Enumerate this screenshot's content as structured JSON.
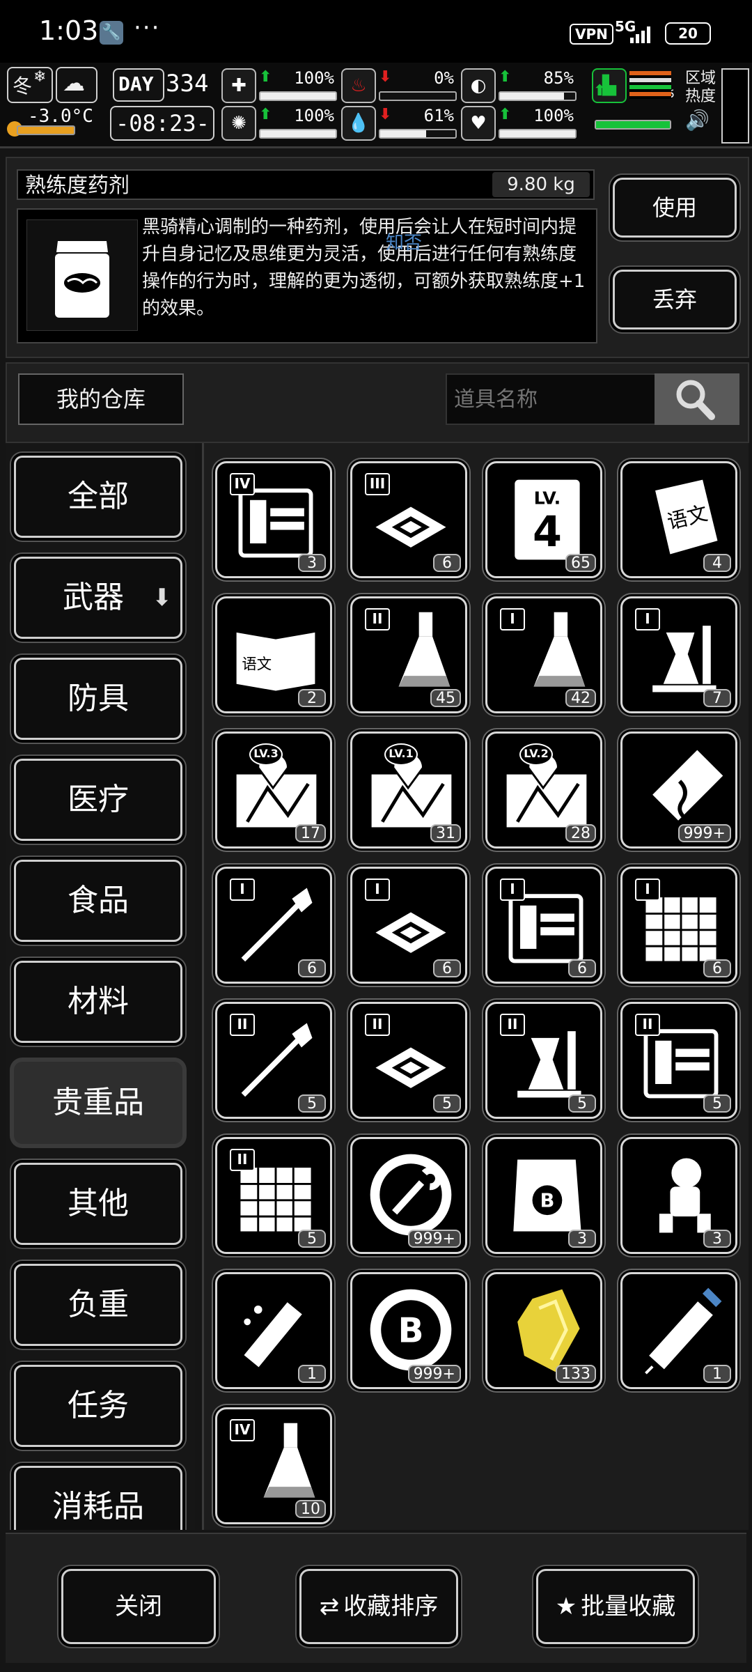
{
  "status_bar": {
    "time": "1:03",
    "dots": "···",
    "vpn": "VPN",
    "network": "5G",
    "battery": "20"
  },
  "hud": {
    "season": "冬",
    "temperature": "-3.0°C",
    "day_label": "DAY",
    "day": "334",
    "clock": "-08:23-",
    "stats": [
      {
        "icon": "medkit-icon",
        "arrow": "up",
        "value": "100%",
        "fill": 1.0
      },
      {
        "icon": "stomach-icon",
        "arrow": "down",
        "value": "0%",
        "fill": 0.0
      },
      {
        "icon": "capsule-icon",
        "arrow": "up",
        "value": "85%",
        "fill": 0.85
      },
      {
        "icon": "brain-icon",
        "arrow": "up",
        "value": "100%",
        "fill": 1.0
      },
      {
        "icon": "water-drop-icon",
        "arrow": "down",
        "value": "61%",
        "fill": 0.61
      },
      {
        "icon": "heart-icon",
        "arrow": "up",
        "value": "100%",
        "fill": 1.0
      },
      {
        "icon": "boot-icon",
        "arrow": "up",
        "value": "100%",
        "fill": 1.0
      }
    ],
    "zone_heat_label": "区域\n热度"
  },
  "item": {
    "name": "熟练度药剂",
    "weight": "9.80 kg",
    "description": "黑骑精心调制的一种药剂，使用后会让人在短时间内提升自身记忆及思维更为灵活，使用后进行任何有熟练度操作的行为时，理解的更为透彻，可额外获取熟练度+1的效果。",
    "watermark": "知否",
    "use_label": "使用",
    "discard_label": "丢弃"
  },
  "warehouse": {
    "title": "我的仓库",
    "search_placeholder": "道具名称"
  },
  "categories": [
    {
      "label": "全部",
      "active": false
    },
    {
      "label": "武器",
      "active": false
    },
    {
      "label": "防具",
      "active": false
    },
    {
      "label": "医疗",
      "active": false
    },
    {
      "label": "食品",
      "active": false
    },
    {
      "label": "材料",
      "active": false
    },
    {
      "label": "贵重品",
      "active": true
    },
    {
      "label": "其他",
      "active": false
    },
    {
      "label": "负重",
      "active": false
    },
    {
      "label": "任务",
      "active": false
    },
    {
      "label": "消耗品",
      "active": false
    }
  ],
  "items": [
    {
      "icon": "blueprint-machine-icon",
      "tier": "IV",
      "count": "3"
    },
    {
      "icon": "chip-icon",
      "tier": "III",
      "count": "6"
    },
    {
      "icon": "level-book-icon",
      "tier": "",
      "count": "65"
    },
    {
      "icon": "chinese-book-icon",
      "tier": "",
      "count": "4"
    },
    {
      "icon": "open-chinese-book-icon",
      "tier": "",
      "count": "2"
    },
    {
      "icon": "potion-flask-icon",
      "tier": "II",
      "count": "45"
    },
    {
      "icon": "potion-flask-icon",
      "tier": "I",
      "count": "42"
    },
    {
      "icon": "lab-equipment-icon",
      "tier": "I",
      "count": "7"
    },
    {
      "icon": "map-lv3-icon",
      "tier": "LV.3",
      "count": "17"
    },
    {
      "icon": "map-lv1-icon",
      "tier": "LV.1",
      "count": "31"
    },
    {
      "icon": "map-lv2-icon",
      "tier": "LV.2",
      "count": "28"
    },
    {
      "icon": "dna-ticket-icon",
      "tier": "",
      "count": "999+"
    },
    {
      "icon": "spear-icon",
      "tier": "I",
      "count": "6"
    },
    {
      "icon": "chip-icon",
      "tier": "I",
      "count": "6"
    },
    {
      "icon": "blueprint-machine-icon",
      "tier": "I",
      "count": "6"
    },
    {
      "icon": "grid-blueprint-icon",
      "tier": "I",
      "count": "6"
    },
    {
      "icon": "spear-icon",
      "tier": "II",
      "count": "5"
    },
    {
      "icon": "chip-icon",
      "tier": "II",
      "count": "5"
    },
    {
      "icon": "lab-equipment-icon",
      "tier": "II",
      "count": "5"
    },
    {
      "icon": "blueprint-machine-icon",
      "tier": "II",
      "count": "5"
    },
    {
      "icon": "grid-blueprint-icon",
      "tier": "II",
      "count": "5"
    },
    {
      "icon": "wrench-coin-icon",
      "tier": "",
      "count": "999+"
    },
    {
      "icon": "b-crest-card-icon",
      "tier": "",
      "count": "3"
    },
    {
      "icon": "astronaut-icon",
      "tier": "",
      "count": "3"
    },
    {
      "icon": "broken-syringe-icon",
      "tier": "",
      "count": "1"
    },
    {
      "icon": "b-coin-icon",
      "tier": "",
      "count": "999+"
    },
    {
      "icon": "gold-crystal-icon",
      "tier": "",
      "count": "133"
    },
    {
      "icon": "syringe-icon",
      "tier": "",
      "count": "1"
    },
    {
      "icon": "potion-flask-icon",
      "tier": "IV",
      "count": "10"
    }
  ],
  "bottom": {
    "close_label": "关闭",
    "sort_label": "收藏排序",
    "batch_label": "批量收藏"
  },
  "colors": {
    "accent_green": "#17c23a",
    "arrow_up": "#17c23a",
    "arrow_down": "#e02020",
    "gold": "#e8d23a"
  }
}
